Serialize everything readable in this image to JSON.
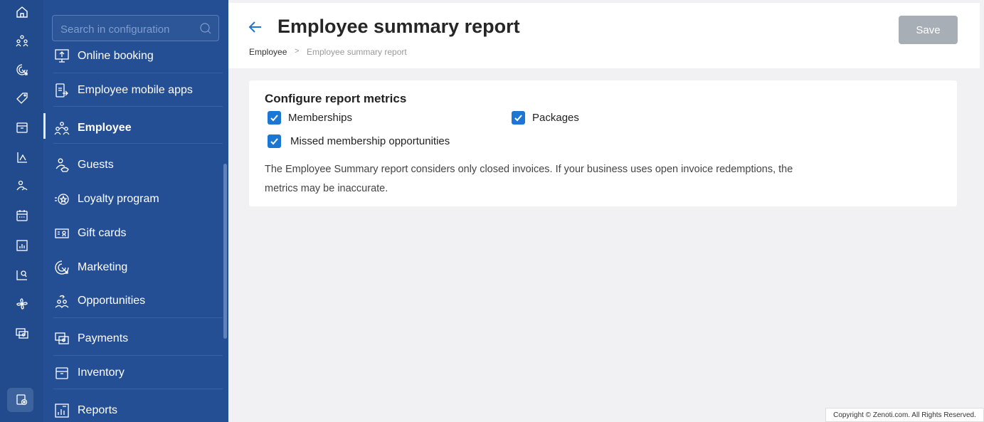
{
  "rail": {
    "icons": [
      "home-icon",
      "people-icon",
      "marketing-icon",
      "tag-icon",
      "calendar-box-icon",
      "chart-icon",
      "guest-icon",
      "calendar-icon",
      "reports-icon",
      "analytics-icon",
      "fan-icon",
      "money-icon",
      "settings-icon"
    ]
  },
  "search": {
    "placeholder": "Search in configuration"
  },
  "sidebar": {
    "items": [
      {
        "label": "Online booking",
        "icon": "monitor-upload-icon"
      },
      {
        "label": "Employee mobile apps",
        "icon": "mobile-app-icon"
      },
      {
        "label": "Employee",
        "icon": "employee-group-icon"
      },
      {
        "label": "Guests",
        "icon": "guest-icon"
      },
      {
        "label": "Loyalty program",
        "icon": "loyalty-star-icon"
      },
      {
        "label": "Gift cards",
        "icon": "gift-card-icon"
      },
      {
        "label": "Marketing",
        "icon": "marketing-icon"
      },
      {
        "label": "Opportunities",
        "icon": "opportunities-icon"
      },
      {
        "label": "Payments",
        "icon": "payments-icon"
      },
      {
        "label": "Inventory",
        "icon": "inventory-box-icon"
      },
      {
        "label": "Reports",
        "icon": "reports-icon"
      }
    ]
  },
  "header": {
    "title": "Employee summary report",
    "breadcrumb": [
      "Employee",
      "Employee summary report"
    ],
    "breadcrumb_separator": ">",
    "save_label": "Save"
  },
  "card": {
    "title": "Configure report metrics",
    "options": [
      {
        "label": "Memberships",
        "checked": true
      },
      {
        "label": "Packages",
        "checked": true
      },
      {
        "label": "Missed membership opportunities",
        "checked": true
      }
    ],
    "note": "The Employee Summary report considers only closed invoices. If your business uses open invoice redemptions, the metrics may be inaccurate."
  },
  "footer": {
    "copyright": "Copyright © Zenoti.com. All Rights Reserved."
  },
  "colors": {
    "rail": "#214b8d",
    "sidebar": "#254f95",
    "accent": "#1c77d4",
    "save_disabled": "#a8aeb6"
  }
}
